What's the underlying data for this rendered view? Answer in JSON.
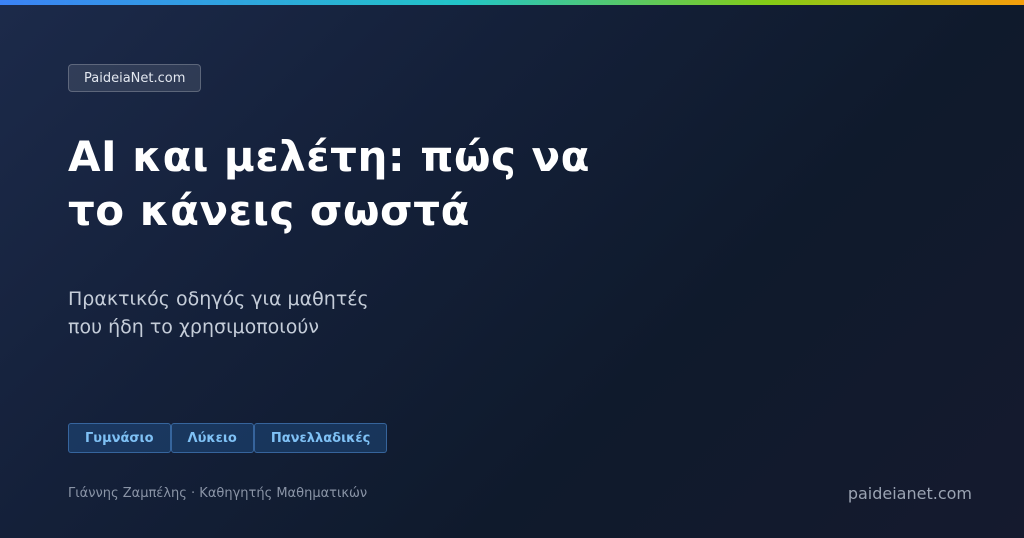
{
  "brand": {
    "badge_label": "PaideiaNet.com",
    "domain": "paideianet.com",
    "accent_colors": [
      "#3b82f6",
      "#22c5c8",
      "#84cc16",
      "#f59e0b"
    ]
  },
  "headline": {
    "lines": [
      "AI και μελέτη: πώς να",
      "το κάνεις σωστά"
    ]
  },
  "subheadline": {
    "lines": [
      "Πρακτικός οδηγός για μαθητές",
      "που ήδη το χρησιμοποιούν"
    ]
  },
  "tags": [
    "Γυμνάσιο",
    "Λύκειο",
    "Πανελλαδικές"
  ],
  "author": {
    "byline": "Γιάννης Ζαμπέλης · Καθηγητής Μαθηματικών"
  }
}
